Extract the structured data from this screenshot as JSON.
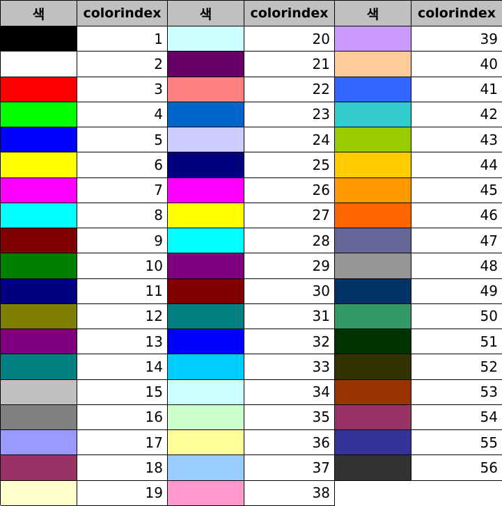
{
  "headers": [
    "색",
    "colorindex",
    "색",
    "colorindex",
    "색",
    "colorindex"
  ],
  "colors": [
    {
      "index": "1",
      "color": "#000000"
    },
    {
      "index": "2",
      "color": "#ffffff"
    },
    {
      "index": "3",
      "color": "#ff0000"
    },
    {
      "index": "4",
      "color": "#00ff00"
    },
    {
      "index": "5",
      "color": "#0000ff"
    },
    {
      "index": "6",
      "color": "#ffff00"
    },
    {
      "index": "7",
      "color": "#ff00ff"
    },
    {
      "index": "8",
      "color": "#00ffff"
    },
    {
      "index": "9",
      "color": "#800000"
    },
    {
      "index": "10",
      "color": "#008000"
    },
    {
      "index": "11",
      "color": "#000080"
    },
    {
      "index": "12",
      "color": "#808000"
    },
    {
      "index": "13",
      "color": "#800080"
    },
    {
      "index": "14",
      "color": "#008080"
    },
    {
      "index": "15",
      "color": "#c0c0c0"
    },
    {
      "index": "16",
      "color": "#808080"
    },
    {
      "index": "17",
      "color": "#9999ff"
    },
    {
      "index": "18",
      "color": "#993366"
    },
    {
      "index": "19",
      "color": "#ffffcc"
    },
    {
      "index": "20",
      "color": "#ccffff"
    },
    {
      "index": "21",
      "color": "#660066"
    },
    {
      "index": "22",
      "color": "#ff8080"
    },
    {
      "index": "23",
      "color": "#0066cc"
    },
    {
      "index": "24",
      "color": "#ccccff"
    },
    {
      "index": "25",
      "color": "#000080"
    },
    {
      "index": "26",
      "color": "#ff00ff"
    },
    {
      "index": "27",
      "color": "#ffff00"
    },
    {
      "index": "28",
      "color": "#00ffff"
    },
    {
      "index": "29",
      "color": "#800080"
    },
    {
      "index": "30",
      "color": "#800000"
    },
    {
      "index": "31",
      "color": "#008080"
    },
    {
      "index": "32",
      "color": "#0000ff"
    },
    {
      "index": "33",
      "color": "#00ccff"
    },
    {
      "index": "34",
      "color": "#ccffff"
    },
    {
      "index": "35",
      "color": "#ccffcc"
    },
    {
      "index": "36",
      "color": "#ffff99"
    },
    {
      "index": "37",
      "color": "#99ccff"
    },
    {
      "index": "38",
      "color": "#ff99cc"
    },
    {
      "index": "39",
      "color": "#cc99ff"
    },
    {
      "index": "40",
      "color": "#ffcc99"
    },
    {
      "index": "41",
      "color": "#3366ff"
    },
    {
      "index": "42",
      "color": "#33cccc"
    },
    {
      "index": "43",
      "color": "#99cc00"
    },
    {
      "index": "44",
      "color": "#ffcc00"
    },
    {
      "index": "45",
      "color": "#ff9900"
    },
    {
      "index": "46",
      "color": "#ff6600"
    },
    {
      "index": "47",
      "color": "#666699"
    },
    {
      "index": "48",
      "color": "#969696"
    },
    {
      "index": "49",
      "color": "#003366"
    },
    {
      "index": "50",
      "color": "#339966"
    },
    {
      "index": "51",
      "color": "#003300"
    },
    {
      "index": "52",
      "color": "#333300"
    },
    {
      "index": "53",
      "color": "#993300"
    },
    {
      "index": "54",
      "color": "#993366"
    },
    {
      "index": "55",
      "color": "#333399"
    },
    {
      "index": "56",
      "color": "#333333"
    }
  ]
}
